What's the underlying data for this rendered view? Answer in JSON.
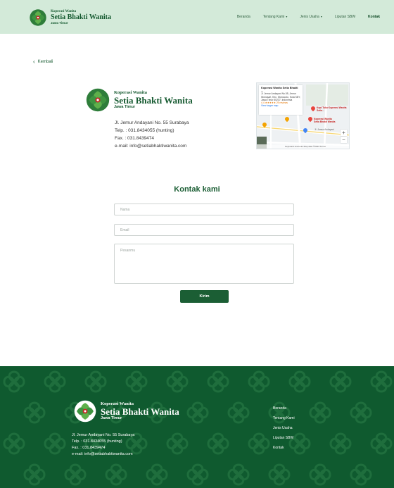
{
  "brand": {
    "small": "Koperasi Wanita",
    "name": "Setia Bhakti Wanita",
    "region": "Jawa Timur"
  },
  "nav": {
    "items": [
      {
        "label": "Beranda"
      },
      {
        "label": "Tentang Kami",
        "caret": "▾"
      },
      {
        "label": "Jenis Usaha",
        "caret": "▾"
      },
      {
        "label": "Liputan SBW"
      },
      {
        "label": "Kontak"
      }
    ],
    "active": "Kontak"
  },
  "back": {
    "label": "Kembali"
  },
  "info": {
    "lines": [
      "Jl. Jemur Andayani No. 55 Surabaya",
      "Telp. : 031.8434055 (hunting)",
      "Fax. : 031.8439474",
      "e-mail: info@setiabhaktiwanita.com"
    ]
  },
  "map": {
    "card_title": "Koperasi Wanita Setia Bhakti ...",
    "card_address": "Jl. Jemur Andayani No.55, Jemur Wonosari, Kec. Wonocolo, Kota SBY, Jawa Timur 60237, Indonesia",
    "card_rating": "4.4 ★★★★★ 29 reviews",
    "card_link": "View larger map",
    "place_label_1": "Kopi Tuku Koperasi Wanita Setia...",
    "place_label_2": "Koperasi Wanita Setia Bhakti Wanita",
    "road_label": "Jl. Jemur Andayani",
    "footer": "Keyboard shortcuts  Map data ©2023  Terms",
    "zoom_in": "+",
    "zoom_out": "−"
  },
  "contact": {
    "title": "Kontak kami",
    "name_placeholder": "Nama",
    "email_placeholder": "Email",
    "message_placeholder": "Pesanmu",
    "submit_label": "Kirim"
  },
  "footer": {
    "lines": [
      "Jl. Jemur Andayani No. 55 Surabaya",
      "Telp. : 031.8434055 (hunting)",
      "Fax. : 031.8439474",
      "e-mail: info@setiabhaktiwanita.com"
    ],
    "nav": [
      "Beranda",
      "Tentang Kami",
      "Jenis Usaha",
      "Liputan SBW",
      "Kontak"
    ]
  },
  "colors": {
    "brand_green": "#1b5e34",
    "header_bg": "#d3ead9",
    "footer_bg": "#0f5a2f"
  }
}
